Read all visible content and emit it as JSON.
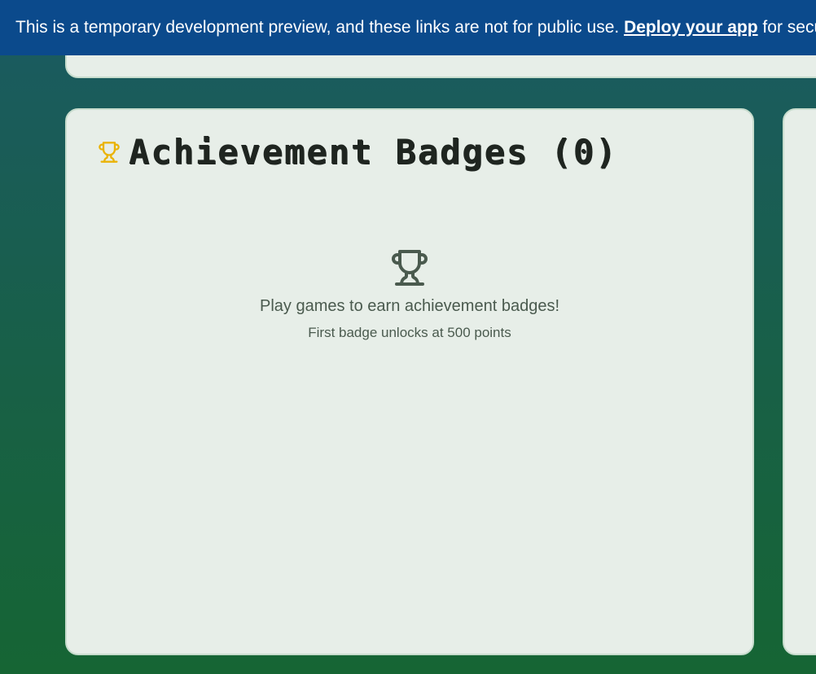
{
  "banner": {
    "text_before": "This is a temporary development preview, and these links are not for public use. ",
    "link_text": "Deploy your app",
    "text_after": " for secur"
  },
  "achievements": {
    "title": "Achievement Badges (0)",
    "header_icon": "trophy-icon",
    "empty_icon": "trophy-icon",
    "empty_title": "Play games to earn achievement badges!",
    "empty_subtitle": "First badge unlocks at 500 points"
  },
  "colors": {
    "banner_bg": "#0b4a8c",
    "card_bg": "#e7eee8",
    "header_icon": "#eab308",
    "empty_icon": "#4a5a4e",
    "title_text": "#1f2520"
  }
}
